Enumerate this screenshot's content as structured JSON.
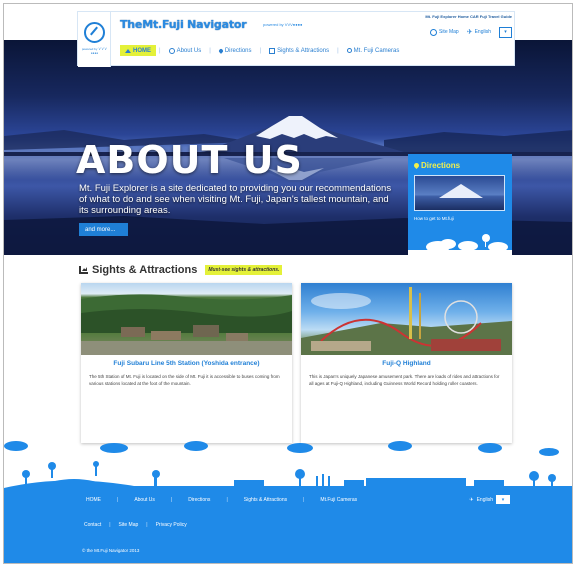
{
  "header": {
    "logo_text": "powered by ＶＶＶ●●●●",
    "brand": "TheMt.Fuji Navigator",
    "brand_sub": "powered by VVV●●●●",
    "tagline": "Mt. Fuji Explorer Home  CAR  Fuji Travel Guide",
    "site_map": "Site Map",
    "language": "English",
    "lang_box": "▾"
  },
  "nav": {
    "items": [
      {
        "label": "HOME",
        "icon": "home-icon"
      },
      {
        "label": "About Us",
        "icon": "info-icon"
      },
      {
        "label": "Directions",
        "icon": "map-pin-icon"
      },
      {
        "label": "Sights & Attractions",
        "icon": "image-icon"
      },
      {
        "label": "Mt. Fuji Cameras",
        "icon": "search-icon"
      }
    ]
  },
  "hero": {
    "title": "ABOUT US",
    "description": "Mt. Fuji Explorer is a site dedicated to providing you our recommendations of what to do and see when visiting Mt. Fuji, Japan's tallest mountain, and its surrounding areas.",
    "button": "and more..."
  },
  "directions": {
    "title": "Directions",
    "caption": "How to get to Mt.fuji"
  },
  "sights": {
    "title": "Sights & Attractions",
    "badge": "Must-see sights & attractions.",
    "cards": [
      {
        "title": "Fuji Subaru Line 5th Station (Yoshida entrance)",
        "text": "The 5th Station of Mt. Fuji is located on the side of Mt. Fuji it is accessible to buses coming from various stations located at the foot of the mountain."
      },
      {
        "title": "Fuji-Q Highland",
        "text": "This is Japan's uniquely Japanese amusement park. There are loads of rides and attractions for all ages at Fuji-Q Highland, including Guinness World Record holding roller coasters."
      }
    ]
  },
  "footer": {
    "nav": [
      "HOME",
      "About Us",
      "Directions",
      "Sights & Attractions",
      "Mt.Fuji Cameras"
    ],
    "language": "English",
    "lang_box": "▾",
    "links": [
      "Contact",
      "Site Map",
      "Privacy Policy"
    ],
    "copyright": "© the Mt.Fuji Navigator 2013"
  },
  "colors": {
    "accent": "#1f8ae8",
    "highlight": "#e4f139",
    "link": "#1f7fd6"
  }
}
